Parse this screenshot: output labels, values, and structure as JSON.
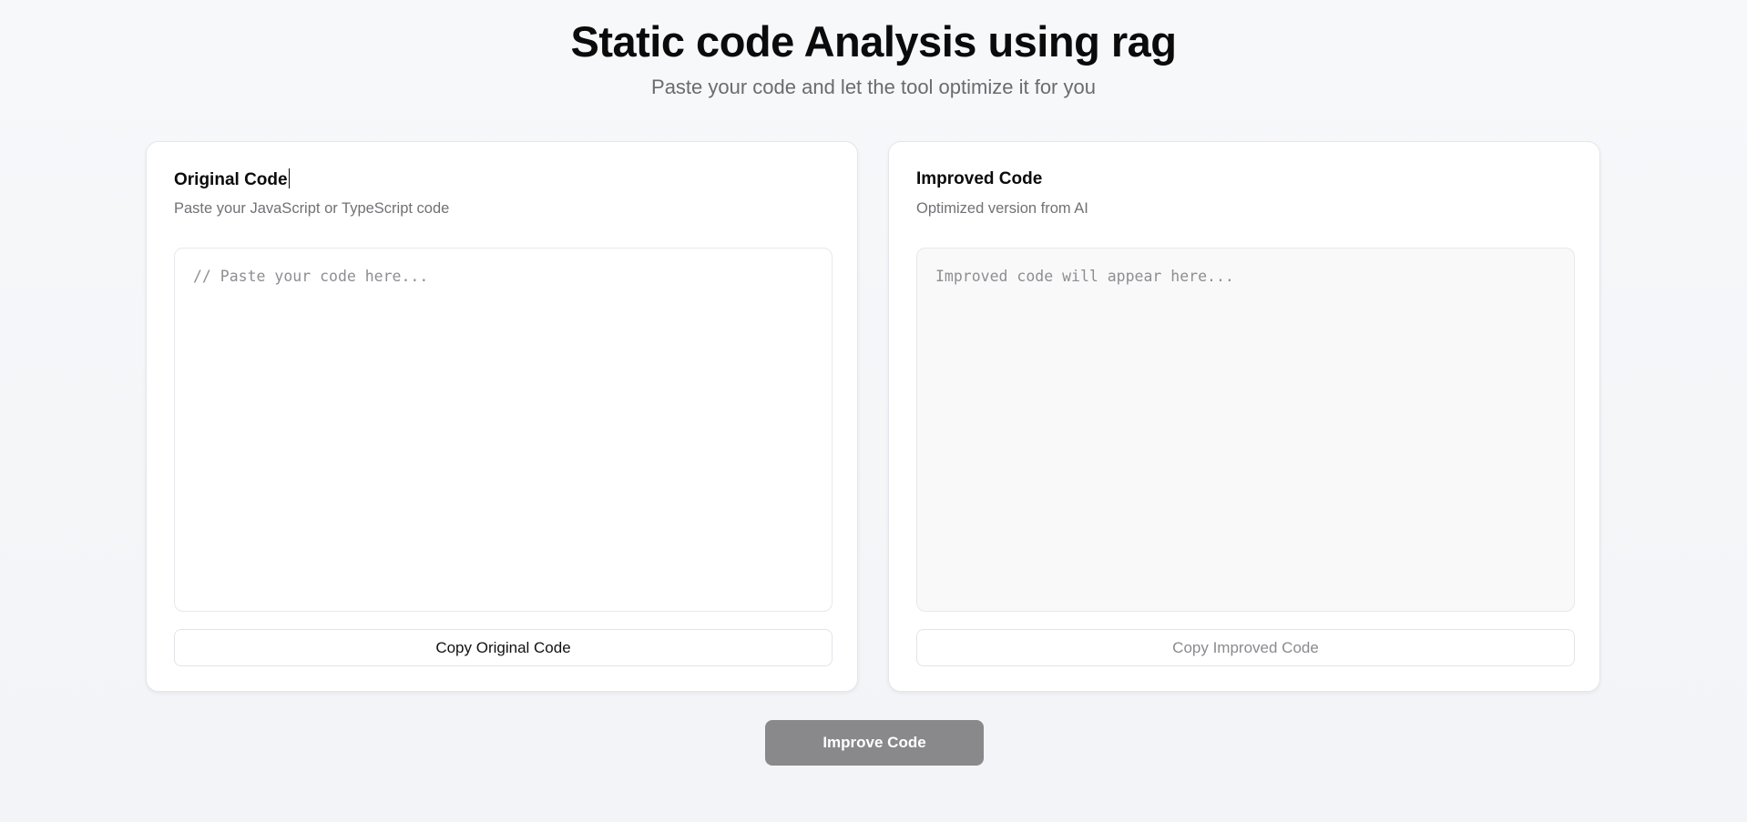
{
  "header": {
    "title": "Static code Analysis using rag",
    "subtitle": "Paste your code and let the tool optimize it for you"
  },
  "original_panel": {
    "title": "Original Code",
    "description": "Paste your JavaScript or TypeScript code",
    "code_value": "",
    "code_placeholder": "// Paste your code here...",
    "copy_label": "Copy Original Code"
  },
  "improved_panel": {
    "title": "Improved Code",
    "description": "Optimized version from AI",
    "code_value": "",
    "code_placeholder": "Improved code will appear here...",
    "copy_label": "Copy Improved Code"
  },
  "actions": {
    "improve_label": "Improve Code"
  },
  "colors": {
    "background": "#f4f6f9",
    "card": "#ffffff",
    "improve_button": "#89898b",
    "muted_text": "#717176"
  }
}
